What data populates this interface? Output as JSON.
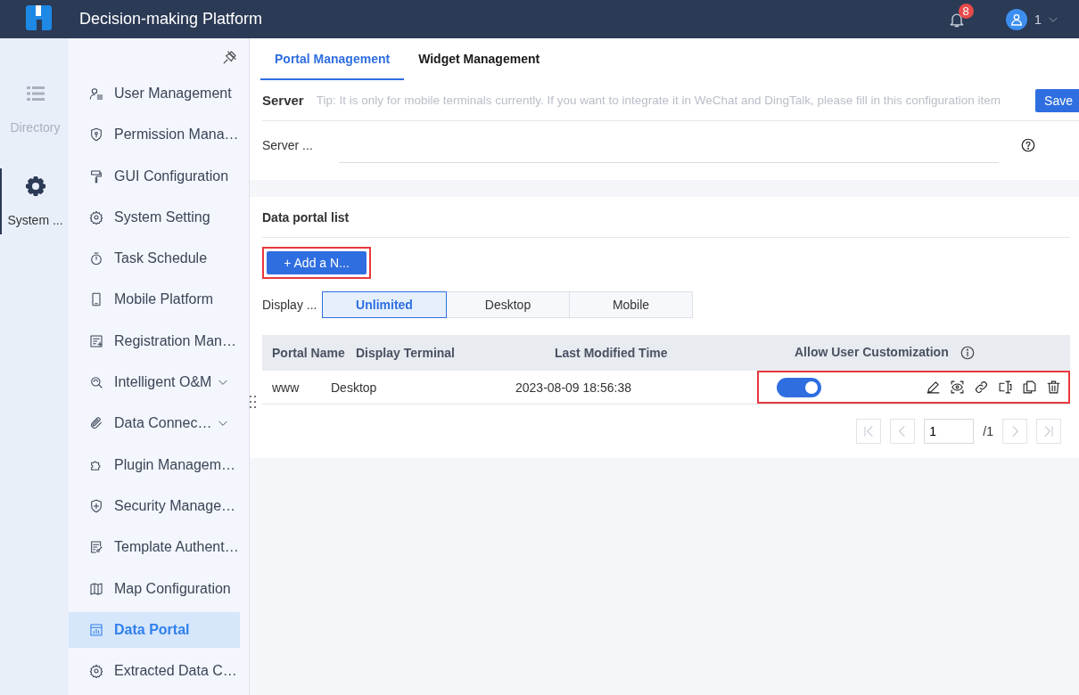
{
  "header": {
    "title": "Decision-making Platform",
    "notification_count": "8",
    "user_name": "1"
  },
  "rail": [
    {
      "label": "Directory",
      "selected": false
    },
    {
      "label": "System ...",
      "selected": true
    }
  ],
  "sidebar": {
    "items": [
      {
        "label": "User Management",
        "selected": false,
        "expandable": false
      },
      {
        "label": "Permission Mana…",
        "selected": false,
        "expandable": false
      },
      {
        "label": "GUI Configuration",
        "selected": false,
        "expandable": false
      },
      {
        "label": "System Setting",
        "selected": false,
        "expandable": false
      },
      {
        "label": "Task Schedule",
        "selected": false,
        "expandable": false
      },
      {
        "label": "Mobile Platform",
        "selected": false,
        "expandable": false
      },
      {
        "label": "Registration Man…",
        "selected": false,
        "expandable": false
      },
      {
        "label": "Intelligent O&M",
        "selected": false,
        "expandable": true
      },
      {
        "label": "Data Connec…",
        "selected": false,
        "expandable": true
      },
      {
        "label": "Plugin Managem…",
        "selected": false,
        "expandable": false
      },
      {
        "label": "Security Manage…",
        "selected": false,
        "expandable": false
      },
      {
        "label": "Template Authent…",
        "selected": false,
        "expandable": false
      },
      {
        "label": "Map Configuration",
        "selected": false,
        "expandable": false
      },
      {
        "label": "Data Portal",
        "selected": true,
        "expandable": false
      },
      {
        "label": "Extracted Data C…",
        "selected": false,
        "expandable": false
      }
    ]
  },
  "tabs": [
    {
      "label": "Portal Management",
      "selected": true
    },
    {
      "label": "Widget Management",
      "selected": false
    }
  ],
  "server": {
    "heading": "Server",
    "tip": "Tip: It is only for mobile terminals currently. If you want to integrate it in WeChat and DingTalk, please fill in this configuration item",
    "save": "Save",
    "field_label": "Server ..."
  },
  "portal_list": {
    "heading": "Data portal list",
    "add_button": {
      "label": "+ Add a N...",
      "highlighted": true
    },
    "filter_label": "Display ...",
    "filters": [
      {
        "label": "Unlimited",
        "selected": true
      },
      {
        "label": "Desktop",
        "selected": false
      },
      {
        "label": "Mobile",
        "selected": false
      }
    ],
    "columns": [
      "Portal Name",
      "Display Terminal",
      "Last Modified Time",
      "Allow User Customization"
    ],
    "rows": [
      {
        "name": "www",
        "terminal": "Desktop",
        "modified": "2023-08-09 18:56:38",
        "allow_customization": true,
        "actions_highlighted": true
      }
    ],
    "pagination": {
      "page": "1",
      "total": "/1"
    }
  }
}
